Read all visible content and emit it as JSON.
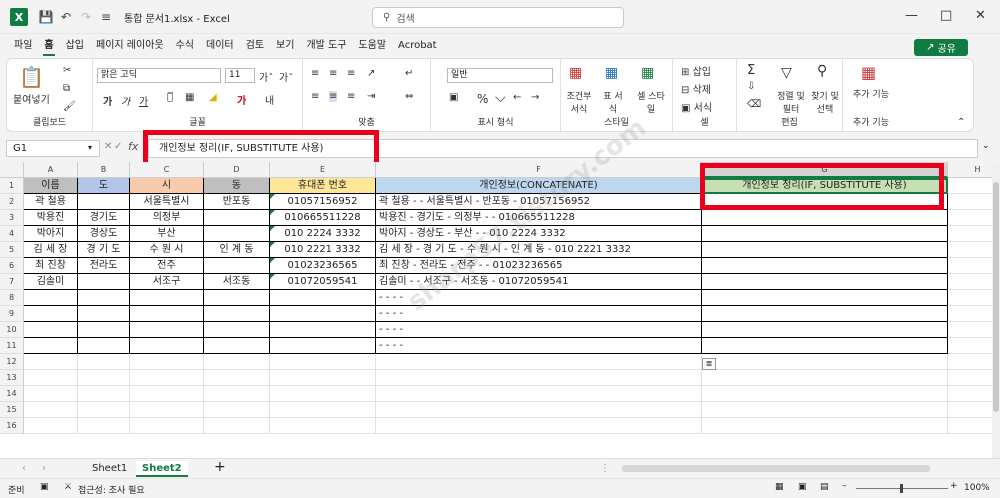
{
  "titlebar": {
    "logo": "X",
    "title": "통합 문서1.xlsx  -  Excel",
    "search_placeholder": "검색",
    "icons": [
      "save-icon",
      "undo-icon",
      "redo-icon",
      "customize-icon"
    ]
  },
  "menu": {
    "items": [
      "파일",
      "홈",
      "삽입",
      "페이지 레이아웃",
      "수식",
      "데이터",
      "검토",
      "보기",
      "개발 도구",
      "도움말",
      "Acrobat"
    ],
    "active": "홈",
    "share": "공유"
  },
  "ribbon": {
    "clipboard": {
      "paste": "붙여넣기",
      "label": "클립보드"
    },
    "font": {
      "name": "맑은 고딕",
      "size": "11",
      "label": "글꼴"
    },
    "align": {
      "label": "맞춤"
    },
    "number": {
      "format": "일반",
      "label": "표시 형식"
    },
    "styles": {
      "cond": "조건부 서식",
      "table": "표 서식",
      "cell": "셀 스타일",
      "label": "스타일"
    },
    "cells": {
      "insert": "삽입",
      "delete": "삭제",
      "format": "서식",
      "label": "셀"
    },
    "edit": {
      "sort": "정렬 및 필터",
      "find": "찾기 및 선택",
      "label": "편집"
    },
    "addin": {
      "name": "추가 기능",
      "label": "추가 기능"
    }
  },
  "formula_bar": {
    "name_box": "G1",
    "fx": "fx",
    "formula": "개인정보 정리(IF, SUBSTITUTE 사용)"
  },
  "grid": {
    "columns": [
      "A",
      "B",
      "C",
      "D",
      "E",
      "F",
      "G",
      "H"
    ],
    "rows": [
      "1",
      "2",
      "3",
      "4",
      "5",
      "6",
      "7",
      "8",
      "9",
      "10",
      "11",
      "12",
      "13",
      "14",
      "15",
      "16"
    ],
    "header_row": [
      "이름",
      "도",
      "시",
      "동",
      "휴대폰 번호",
      "개인정보(CONCATENATE)",
      "개인정보 정리(IF, SUBSTITUTE 사용)"
    ],
    "header_colors": {
      "A": "#bfbfbf",
      "B": "#b4c6e7",
      "C": "#f8cbad",
      "D": "#bfbfbf",
      "E": "#ffe699",
      "F": "#bdd7ee",
      "G": "#c6e0b4"
    },
    "data": [
      [
        "곽 철용",
        "",
        "서울특별시",
        "반포동",
        "01057156952",
        "곽 철용 -  - 서울특별시 - 반포동 - 01057156952",
        ""
      ],
      [
        "박용진",
        "경기도",
        "의정부",
        "",
        "010665511228",
        "박용진 - 경기도 - 의정부 -  - 010665511228",
        ""
      ],
      [
        "박아지",
        "경상도",
        "부산",
        "",
        "010 2224 3332",
        "박아지 - 경상도 - 부산 -  - 010 2224 3332",
        ""
      ],
      [
        "김 세 장",
        "경 기 도",
        "수 원 시",
        "인 계 동",
        "010 2221 3332",
        " 김 세 장 - 경 기 도 - 수 원 시 - 인 계 동 - 010 2221 3332",
        ""
      ],
      [
        "최 진창",
        "전라도",
        "전주",
        "",
        "01023236565",
        "최 진창 - 전라도 - 전주 -  - 01023236565",
        ""
      ],
      [
        "김솔미",
        "",
        "서조구",
        "서조동",
        "01072059541",
        "김솔미 -  - 서조구 - 서조동 - 01072059541",
        ""
      ],
      [
        "",
        "",
        "",
        "",
        "",
        " -  -  -  - ",
        ""
      ],
      [
        "",
        "",
        "",
        "",
        "",
        " -  -  -  - ",
        ""
      ],
      [
        "",
        "",
        "",
        "",
        "",
        " -  -  -  - ",
        ""
      ],
      [
        "",
        "",
        "",
        "",
        "",
        " -  -  -  - ",
        ""
      ]
    ]
  },
  "sheets": {
    "tabs": [
      "Sheet1",
      "Sheet2"
    ],
    "active": "Sheet2"
  },
  "status": {
    "ready": "준비",
    "accessibility": "접근성: 조사 필요",
    "zoom": "100%"
  },
  "watermark": "sharp57.tistory.com"
}
